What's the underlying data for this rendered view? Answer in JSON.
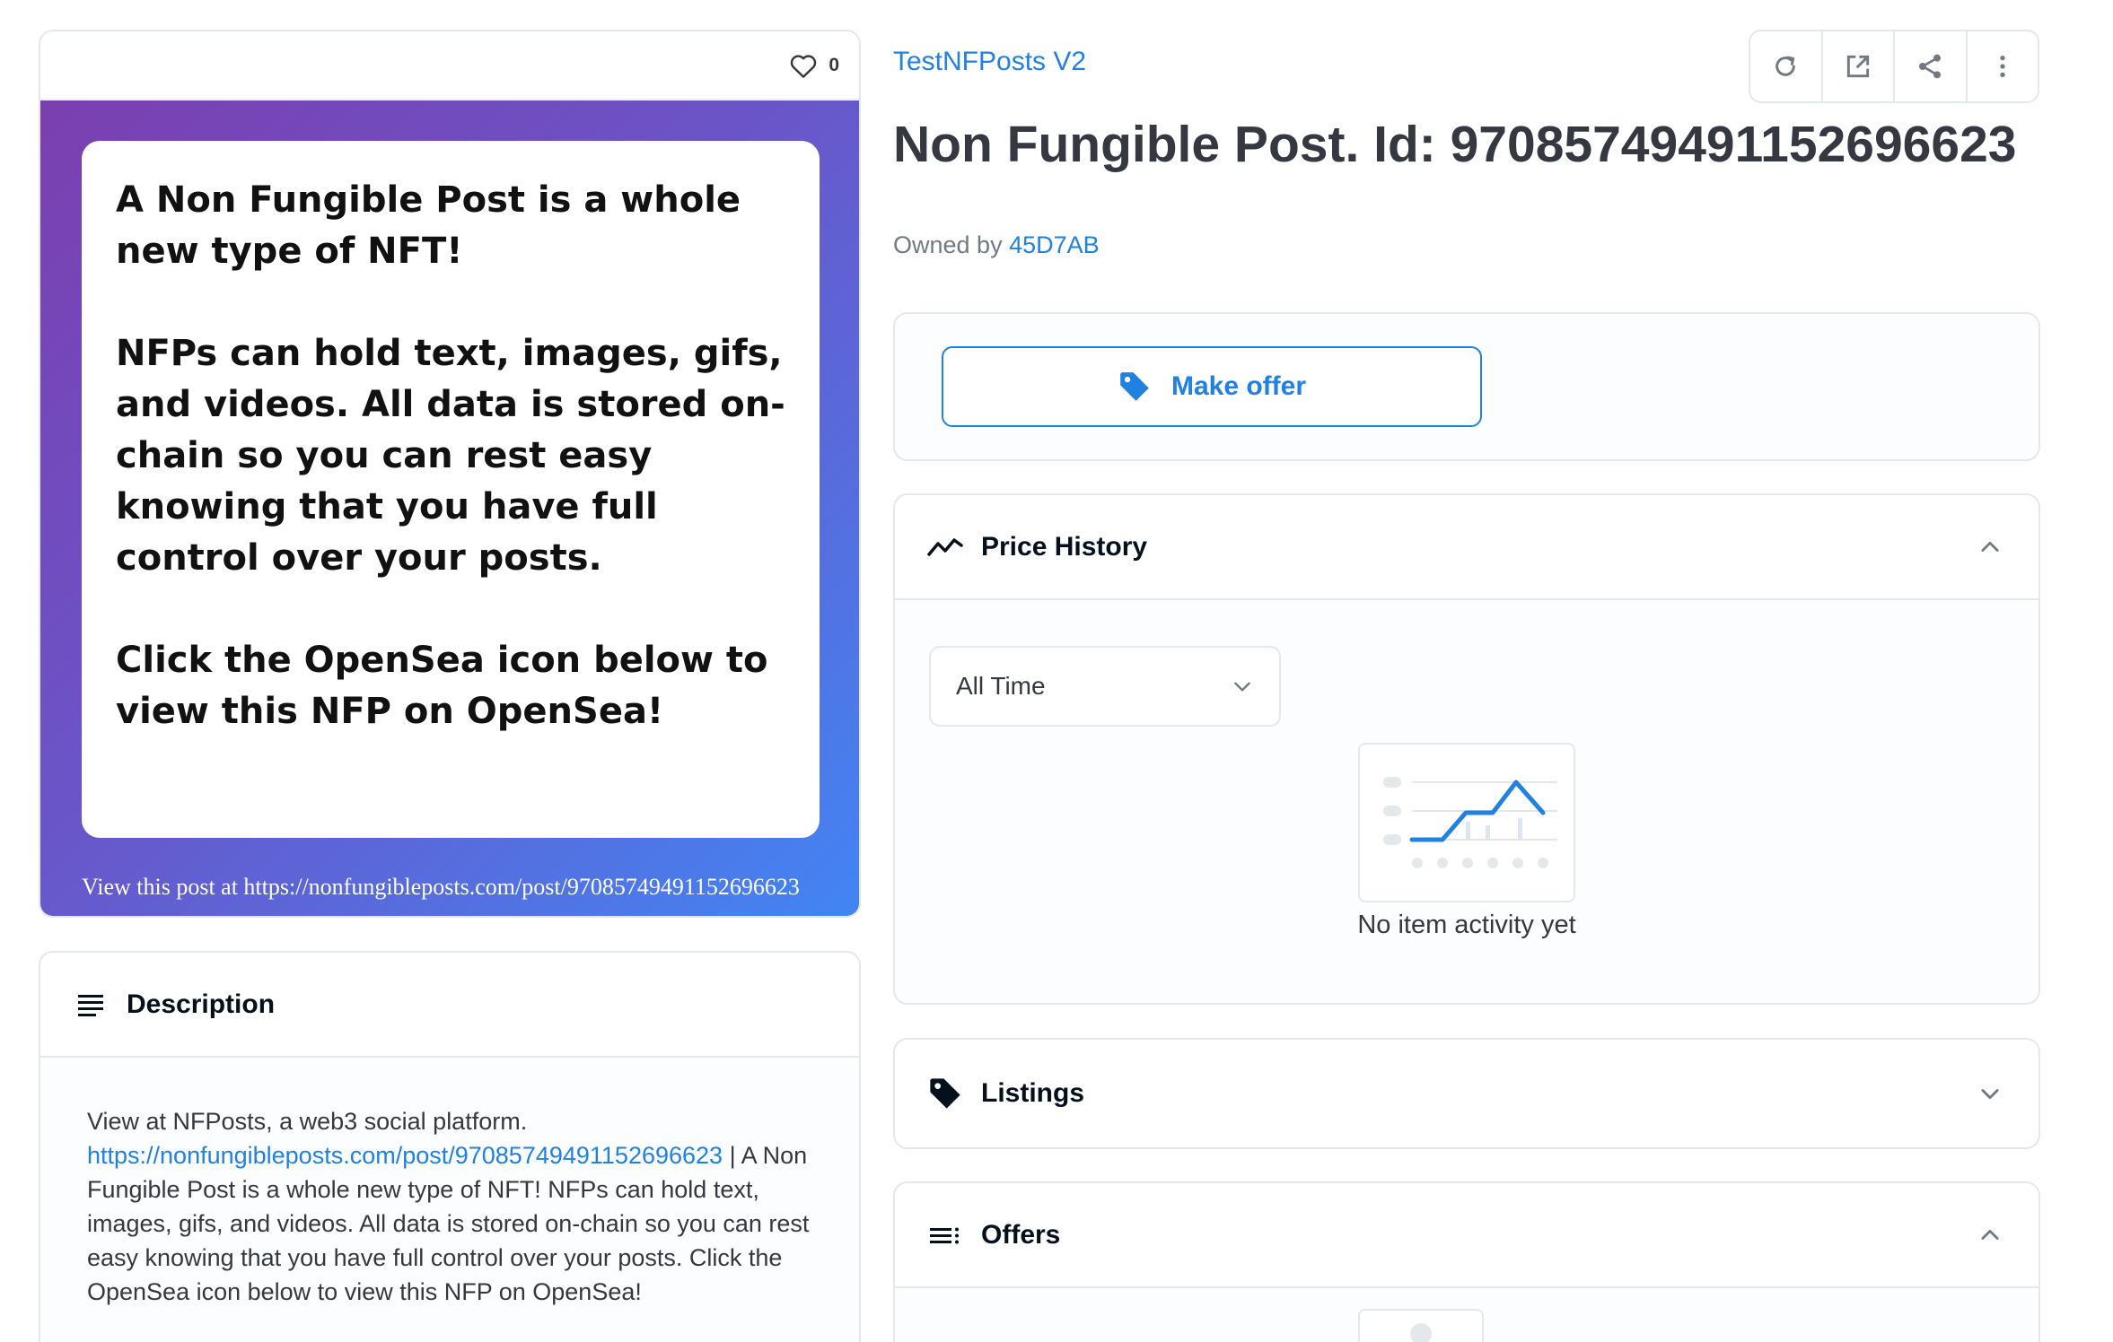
{
  "item": {
    "favorites_count": "0",
    "collection": "TestNFPosts V2",
    "title": "Non Fungible Post. Id: 97085749491152696623",
    "owned_by_prefix": "Owned by ",
    "owner": "45D7AB"
  },
  "artwork": {
    "paragraphs": [
      "A Non Fungible Post is a whole new type of NFT!",
      "NFPs can hold text, images, gifs, and videos. All data is stored on-chain so you can rest easy knowing that you have full control over your posts.",
      "Click the OpenSea icon below to view this NFP on OpenSea!"
    ],
    "footer": "View this post at https://nonfungibleposts.com/post/97085749491152696623",
    "gradient": [
      "#7b3fb0",
      "#4285f4"
    ]
  },
  "description": {
    "title": "Description",
    "intro": "View at NFPosts, a web3 social platform.",
    "link": "https://nonfungibleposts.com/post/97085749491152696623",
    "rest": " | A Non Fungible Post is a whole new type of NFT! NFPs can hold text, images, gifs, and videos. All data is stored on-chain so you can rest easy knowing that you have full control over your posts. Click the OpenSea icon below to view this NFP on OpenSea!"
  },
  "actions": {
    "icons": [
      "refresh-icon",
      "external-link-icon",
      "share-icon",
      "more-icon"
    ]
  },
  "offer": {
    "make_offer_label": "Make offer"
  },
  "price_history": {
    "title": "Price History",
    "time_range": "All Time",
    "empty_text": "No item activity yet"
  },
  "listings": {
    "title": "Listings"
  },
  "offers": {
    "title": "Offers"
  },
  "colors": {
    "accent": "#2081e2",
    "text": "#353840",
    "border": "#e5e8eb"
  }
}
